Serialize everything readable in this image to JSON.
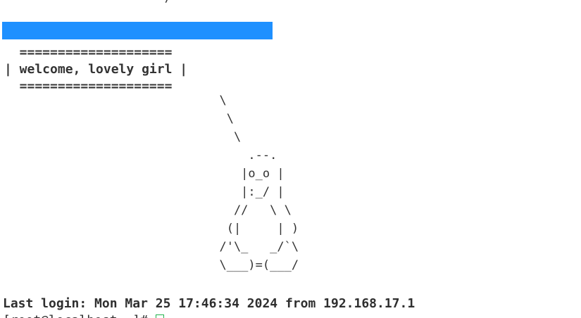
{
  "terminal": {
    "top_line_fragment": "  '     '  '  ' '    /   '    '       '  '",
    "banner_color": "#1e90ff",
    "welcome": {
      "border": "  ====================",
      "message": "| welcome, lovely girl |"
    },
    "tux_ascii": "  \\\n   \\\n    \\\n      .--.\n     |o_o |\n     |:_/ |\n    //   \\ \\\n   (|     | )\n  /'\\_   _/`\\\n  \\___)=(___/",
    "last_login": "Last login: Mon Mar 25 17:46:34 2024 from 192.168.17.1",
    "prompt": "[root@localhost ~]# ",
    "cursor_color": "#22b14c"
  }
}
